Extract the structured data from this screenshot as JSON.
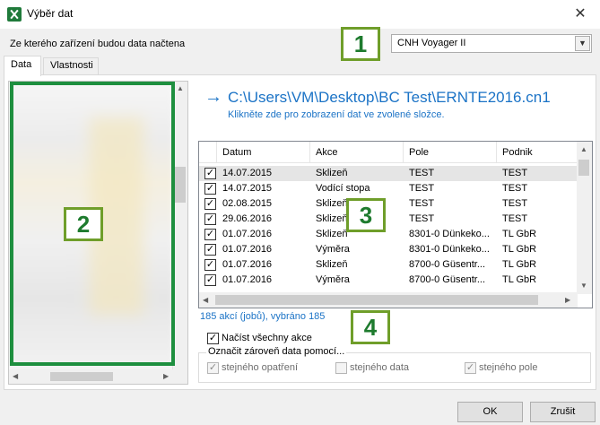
{
  "window": {
    "title": "Výběr dat",
    "close_glyph": "✕"
  },
  "device": {
    "label": "Ze kterého zařízení budou data načtena",
    "selected": "CNH Voyager II",
    "arrow_glyph": "▼"
  },
  "tabs": [
    {
      "label": "Data",
      "active": true
    },
    {
      "label": "Vlastnosti",
      "active": false
    }
  ],
  "callouts": [
    "1",
    "2",
    "3",
    "4"
  ],
  "path": {
    "arrow_glyph": "→",
    "text": "C:\\Users\\VM\\Desktop\\BC Test\\ERNTE2016.cn1",
    "hint": "Klikněte zde pro zobrazení dat ve zvolené složce."
  },
  "table": {
    "columns": [
      "Datum",
      "Akce",
      "Pole",
      "Podnik"
    ],
    "rows": [
      [
        "14.07.2015",
        "Sklizeň",
        "TEST",
        "TEST"
      ],
      [
        "14.07.2015",
        "Vodící stopa",
        "TEST",
        "TEST"
      ],
      [
        "02.08.2015",
        "Sklizeň",
        "TEST",
        "TEST"
      ],
      [
        "29.06.2016",
        "Sklizeň",
        "TEST",
        "TEST"
      ],
      [
        "01.07.2016",
        "Sklizeň",
        "8301-0 Dünkeko...",
        "TL GbR"
      ],
      [
        "01.07.2016",
        "Výměra",
        "8301-0 Dünkeko...",
        "TL GbR"
      ],
      [
        "01.07.2016",
        "Sklizeň",
        "8700-0 Güsentr...",
        "TL GbR"
      ],
      [
        "01.07.2016",
        "Výměra",
        "8700-0 Güsentr...",
        "TL GbR"
      ]
    ],
    "check_glyph": "✓"
  },
  "summary": "185 akcí (jobů), vybráno 185",
  "load_all": {
    "label": "Načíst všechny akce",
    "checked": true
  },
  "mark_group": {
    "title": "Označit zároveň data pomocí...",
    "options": [
      {
        "label": "stejného opatření",
        "checked": true
      },
      {
        "label": "stejného data",
        "checked": false
      },
      {
        "label": "stejného pole",
        "checked": true
      }
    ]
  },
  "buttons": {
    "ok": "OK",
    "cancel": "Zrušit"
  },
  "colors": {
    "accent": "#1b73c6",
    "callout_border": "#6f9e2a",
    "callout_text": "#1e7b2e",
    "highlight_frame": "#1e8f3f"
  }
}
